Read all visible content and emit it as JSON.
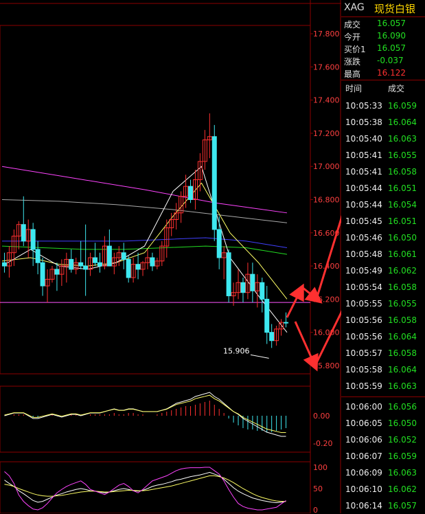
{
  "colors": {
    "bg": "#000000",
    "up": "#ff3030",
    "down": "#3ee8f0",
    "grid": "#8b0000",
    "ma5": "#ffffff",
    "ma10": "#ffff66",
    "ma20": "#ff44ff",
    "ma40": "#22dd22",
    "ma60": "#4040ff",
    "ma_long": "#aaaaaa",
    "arrow": "#ff3030"
  },
  "header": {
    "code": "XAG",
    "name": "现货白银"
  },
  "quote": [
    {
      "label": "成交",
      "value": "16.057",
      "color": "green"
    },
    {
      "label": "今开",
      "value": "16.090",
      "color": "green"
    },
    {
      "label": "买价1",
      "value": "16.057",
      "color": "green"
    },
    {
      "label": "涨跌",
      "value": "-0.037",
      "color": "green"
    },
    {
      "label": "最高",
      "value": "16.122",
      "color": "red"
    }
  ],
  "ticks_header": {
    "time": "时间",
    "price": "成交"
  },
  "ticks": [
    {
      "time": "10:05:33",
      "price": "16.059"
    },
    {
      "time": "10:05:38",
      "price": "16.064"
    },
    {
      "time": "10:05:40",
      "price": "16.063"
    },
    {
      "time": "10:05:41",
      "price": "16.055"
    },
    {
      "time": "10:05:41",
      "price": "16.058"
    },
    {
      "time": "10:05:44",
      "price": "16.051"
    },
    {
      "time": "10:05:44",
      "price": "16.054"
    },
    {
      "time": "10:05:45",
      "price": "16.051"
    },
    {
      "time": "10:05:46",
      "price": "16.050"
    },
    {
      "time": "10:05:48",
      "price": "16.061"
    },
    {
      "time": "10:05:49",
      "price": "16.062"
    },
    {
      "time": "10:05:54",
      "price": "16.058"
    },
    {
      "time": "10:05:55",
      "price": "16.055"
    },
    {
      "time": "10:05:56",
      "price": "16.058"
    },
    {
      "time": "10:05:56",
      "price": "16.064"
    },
    {
      "time": "10:05:57",
      "price": "16.058"
    },
    {
      "time": "10:05:58",
      "price": "16.064"
    },
    {
      "time": "10:05:59",
      "price": "16.063"
    },
    {
      "time": "10:06:00",
      "price": "16.056"
    },
    {
      "time": "10:06:05",
      "price": "16.050"
    },
    {
      "time": "10:06:06",
      "price": "16.052"
    },
    {
      "time": "10:06:07",
      "price": "16.059"
    },
    {
      "time": "10:06:09",
      "price": "16.063"
    },
    {
      "time": "10:06:10",
      "price": "16.062"
    },
    {
      "time": "10:06:14",
      "price": "16.057"
    }
  ],
  "chart_data": {
    "type": "candlestick",
    "price_axis": {
      "ticks": [
        "17.800",
        "17.600",
        "17.400",
        "17.200",
        "17.000",
        "16.800",
        "16.600",
        "16.400",
        "16.200",
        "16.000",
        "15.800"
      ],
      "ylim": [
        15.75,
        17.85
      ]
    },
    "annotation": {
      "label": "15.906",
      "value": 15.906
    },
    "candles": [
      [
        16.42,
        16.48,
        16.36,
        16.4
      ],
      [
        16.4,
        16.52,
        16.33,
        16.48
      ],
      [
        16.48,
        16.62,
        16.4,
        16.58
      ],
      [
        16.58,
        16.67,
        16.5,
        16.65
      ],
      [
        16.65,
        16.82,
        16.52,
        16.55
      ],
      [
        16.55,
        16.68,
        16.45,
        16.62
      ],
      [
        16.62,
        16.66,
        16.4,
        16.5
      ],
      [
        16.5,
        16.55,
        16.35,
        16.42
      ],
      [
        16.42,
        16.45,
        16.22,
        16.28
      ],
      [
        16.28,
        16.38,
        16.18,
        16.32
      ],
      [
        16.32,
        16.4,
        16.3,
        16.38
      ],
      [
        16.38,
        16.42,
        16.25,
        16.35
      ],
      [
        16.35,
        16.44,
        16.28,
        16.4
      ],
      [
        16.4,
        16.48,
        16.3,
        16.44
      ],
      [
        16.44,
        16.5,
        16.36,
        16.38
      ],
      [
        16.38,
        16.45,
        16.35,
        16.42
      ],
      [
        16.42,
        16.55,
        16.38,
        16.4
      ],
      [
        16.4,
        16.65,
        16.22,
        16.38
      ],
      [
        16.38,
        16.48,
        16.34,
        16.45
      ],
      [
        16.45,
        16.54,
        16.4,
        16.42
      ],
      [
        16.42,
        16.48,
        16.36,
        16.4
      ],
      [
        16.4,
        16.58,
        16.38,
        16.52
      ],
      [
        16.52,
        16.62,
        16.42,
        16.4
      ],
      [
        16.4,
        16.48,
        16.35,
        16.45
      ],
      [
        16.45,
        16.52,
        16.4,
        16.48
      ],
      [
        16.48,
        16.54,
        16.38,
        16.44
      ],
      [
        16.44,
        16.46,
        16.3,
        16.33
      ],
      [
        16.33,
        16.45,
        16.3,
        16.41
      ],
      [
        16.41,
        16.48,
        16.32,
        16.38
      ],
      [
        16.38,
        16.43,
        16.34,
        16.42
      ],
      [
        16.42,
        16.5,
        16.38,
        16.45
      ],
      [
        16.45,
        16.48,
        16.37,
        16.4
      ],
      [
        16.4,
        16.45,
        16.38,
        16.43
      ],
      [
        16.43,
        16.55,
        16.4,
        16.52
      ],
      [
        16.52,
        16.68,
        16.45,
        16.63
      ],
      [
        16.63,
        16.72,
        16.58,
        16.68
      ],
      [
        16.68,
        16.78,
        16.62,
        16.72
      ],
      [
        16.72,
        16.85,
        16.66,
        16.82
      ],
      [
        16.82,
        16.95,
        16.75,
        16.88
      ],
      [
        16.88,
        16.92,
        16.78,
        16.8
      ],
      [
        16.8,
        16.98,
        16.74,
        16.92
      ],
      [
        16.92,
        17.08,
        16.85,
        17.03
      ],
      [
        17.03,
        17.22,
        16.98,
        17.16
      ],
      [
        17.16,
        17.32,
        17.05,
        17.18
      ],
      [
        17.18,
        17.25,
        16.55,
        16.62
      ],
      [
        16.62,
        16.7,
        16.38,
        16.45
      ],
      [
        16.45,
        16.52,
        16.32,
        16.48
      ],
      [
        16.48,
        16.5,
        16.18,
        16.22
      ],
      [
        16.22,
        16.3,
        16.16,
        16.24
      ],
      [
        16.24,
        16.38,
        16.2,
        16.3
      ],
      [
        16.3,
        16.33,
        16.18,
        16.24
      ],
      [
        16.24,
        16.42,
        16.2,
        16.35
      ],
      [
        16.35,
        16.42,
        16.18,
        16.25
      ],
      [
        16.25,
        16.35,
        16.15,
        16.3
      ],
      [
        16.3,
        16.33,
        16.12,
        16.2
      ],
      [
        16.2,
        16.28,
        15.93,
        16.0
      ],
      [
        16.0,
        16.05,
        15.906,
        15.95
      ],
      [
        15.95,
        16.04,
        15.92,
        16.02
      ],
      [
        16.02,
        16.08,
        15.98,
        16.06
      ],
      [
        16.06,
        16.12,
        16.03,
        16.057
      ]
    ],
    "moving_averages": [
      {
        "color": "ma20",
        "values": [
          17.0,
          16.93,
          16.86,
          16.78,
          16.72
        ]
      },
      {
        "color": "ma_long",
        "values": [
          16.8,
          16.79,
          16.77,
          16.74,
          16.7,
          16.66
        ]
      },
      {
        "color": "ma40",
        "values": [
          16.52,
          16.51,
          16.5,
          16.5,
          16.51,
          16.52,
          16.51,
          16.47
        ]
      },
      {
        "color": "ma60",
        "values": [
          16.55,
          16.55,
          16.55,
          16.55,
          16.56,
          16.57,
          16.55,
          16.51
        ]
      },
      {
        "color": "ma10",
        "values": [
          16.43,
          16.45,
          16.41,
          16.4,
          16.42,
          16.48,
          16.7,
          16.9,
          16.6,
          16.42,
          16.2
        ]
      },
      {
        "color": "ma5",
        "values": [
          16.4,
          16.5,
          16.4,
          16.38,
          16.42,
          16.52,
          16.85,
          17.0,
          16.45,
          16.22,
          16.0
        ]
      }
    ],
    "horizontal_line": 16.18,
    "macd": {
      "axis_ticks": [
        "0.00",
        "-0.20"
      ],
      "dif": [
        0.0,
        0.01,
        0.02,
        0.02,
        0.02,
        0.0,
        -0.02,
        -0.02,
        -0.01,
        0.0,
        0.01,
        0.0,
        -0.01,
        0.0,
        0.01,
        0.01,
        0.0,
        0.01,
        0.02,
        0.02,
        0.02,
        0.03,
        0.04,
        0.05,
        0.04,
        0.04,
        0.05,
        0.05,
        0.04,
        0.03,
        0.03,
        0.03,
        0.03,
        0.04,
        0.05,
        0.07,
        0.09,
        0.1,
        0.11,
        0.12,
        0.14,
        0.15,
        0.16,
        0.17,
        0.14,
        0.12,
        0.09,
        0.06,
        0.03,
        0.01,
        -0.02,
        -0.04,
        -0.06,
        -0.08,
        -0.1,
        -0.12,
        -0.13,
        -0.14,
        -0.15,
        -0.15
      ],
      "hist": [
        0.0,
        0.0,
        0.01,
        0.01,
        0.01,
        0.0,
        -0.01,
        -0.01,
        0.0,
        0.0,
        0.01,
        0.0,
        0.0,
        0.0,
        0.01,
        0.01,
        0.0,
        0.0,
        0.01,
        0.01,
        0.01,
        0.01,
        0.01,
        0.02,
        0.01,
        0.01,
        0.02,
        0.02,
        0.01,
        0.01,
        0.0,
        0.0,
        0.01,
        0.02,
        0.03,
        0.04,
        0.05,
        0.06,
        0.07,
        0.07,
        0.08,
        0.09,
        0.1,
        0.11,
        0.08,
        0.05,
        0.02,
        -0.02,
        -0.05,
        -0.07,
        -0.09,
        -0.1,
        -0.1,
        -0.11,
        -0.11,
        -0.12,
        -0.12,
        -0.11,
        -0.1,
        -0.09
      ]
    },
    "kdj": {
      "axis_ticks": [
        "100",
        "50",
        "0"
      ],
      "k": [
        70,
        62,
        55,
        45,
        38,
        30,
        22,
        18,
        20,
        25,
        30,
        35,
        38,
        42,
        45,
        48,
        50,
        48,
        45,
        44,
        42,
        40,
        42,
        45,
        48,
        50,
        48,
        45,
        44,
        46,
        50,
        55,
        58,
        60,
        63,
        66,
        70,
        72,
        75,
        78,
        80,
        82,
        85,
        88,
        84,
        80,
        72,
        62,
        52,
        44,
        38,
        33,
        28,
        25,
        22,
        20,
        18,
        17,
        18,
        20
      ],
      "d": [
        60,
        58,
        55,
        50,
        46,
        42,
        38,
        35,
        33,
        32,
        32,
        33,
        34,
        36,
        38,
        40,
        42,
        43,
        44,
        44,
        43,
        42,
        42,
        43,
        44,
        45,
        46,
        46,
        45,
        45,
        46,
        48,
        50,
        52,
        54,
        56,
        59,
        62,
        65,
        68,
        71,
        74,
        77,
        80,
        80,
        78,
        75,
        70,
        64,
        57,
        50,
        44,
        38,
        33,
        29,
        26,
        23,
        21,
        20,
        20
      ],
      "j": [
        90,
        80,
        62,
        35,
        20,
        10,
        2,
        0,
        5,
        15,
        28,
        40,
        48,
        55,
        60,
        64,
        68,
        60,
        48,
        44,
        40,
        36,
        42,
        50,
        58,
        62,
        55,
        45,
        40,
        48,
        58,
        68,
        72,
        76,
        80,
        86,
        92,
        96,
        98,
        99,
        99,
        99,
        100,
        100,
        92,
        84,
        68,
        48,
        30,
        15,
        8,
        4,
        2,
        0,
        0,
        2,
        4,
        6,
        14,
        22
      ]
    }
  }
}
